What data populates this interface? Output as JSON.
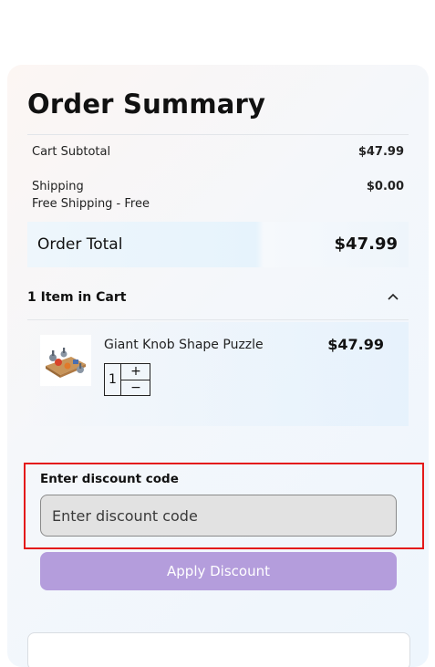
{
  "summary": {
    "title": "Order Summary",
    "subtotal_label": "Cart Subtotal",
    "subtotal_value": "$47.99",
    "shipping_label": "Shipping",
    "shipping_detail": "Free Shipping - Free",
    "shipping_value": "$0.00",
    "total_label": "Order Total",
    "total_value": "$47.99"
  },
  "cart": {
    "items_heading": "1 Item in Cart",
    "items": [
      {
        "name": "Giant Knob Shape Puzzle",
        "price": "$47.99",
        "quantity": "1",
        "increment_label": "+",
        "decrement_label": "−"
      }
    ]
  },
  "discount": {
    "label": "Enter discount code",
    "placeholder": "Enter discount code",
    "value": "",
    "apply_label": "Apply Discount"
  },
  "colors": {
    "apply_button": "#b49ddc",
    "highlight_border": "#e41a1a"
  }
}
